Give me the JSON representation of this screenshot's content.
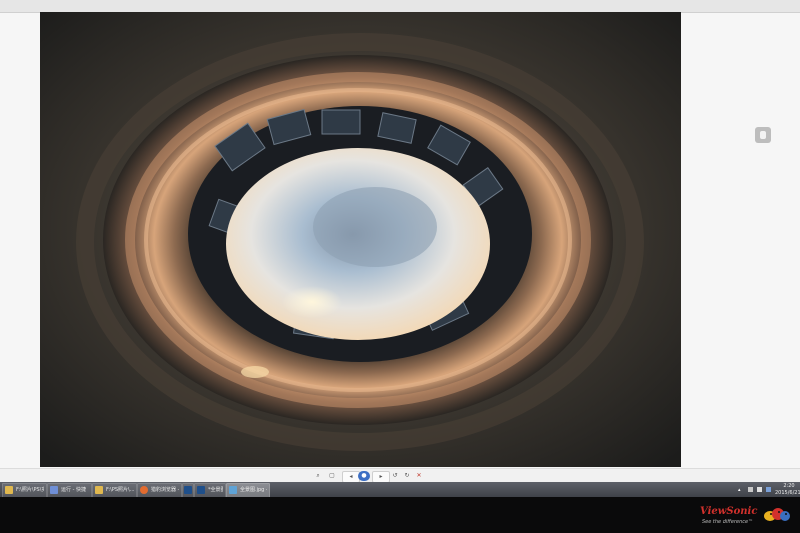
{
  "window": {
    "title": ""
  },
  "photo": {
    "description_icon": "tiny-planet-photo",
    "sky_color": "#a9bdd0",
    "glow_color": "#f2d9b8",
    "ring_color": "#d7a47a"
  },
  "side_button": {
    "icon": "page-icon"
  },
  "toolbar": {
    "buttons": [
      {
        "icon": "zoom-icon",
        "label": ""
      },
      {
        "icon": "fit-icon",
        "label": ""
      },
      {
        "icon": "slideshow-icon",
        "label": ""
      },
      {
        "icon": "rotate-left-icon",
        "label": ""
      },
      {
        "icon": "rotate-right-icon",
        "label": ""
      },
      {
        "icon": "delete-icon",
        "label": ""
      }
    ]
  },
  "taskbar": {
    "items": [
      {
        "icon": "folder-icon",
        "label": "F:\\照片\\PS\\实验"
      },
      {
        "icon": "app-icon",
        "label": "运行 - 快捷"
      },
      {
        "icon": "folder-icon",
        "label": "F:\\PS照片\\..."
      },
      {
        "icon": "browser-icon",
        "label": "猎豹浏览器 - 小生..."
      },
      {
        "icon": "photoshop-icon",
        "label": "Ps"
      },
      {
        "icon": "photoshop-icon",
        "label": "*全景图.psd @..."
      },
      {
        "icon": "image-viewer-icon",
        "label": "全景图.jpg - 照..."
      }
    ],
    "clock_time": "2:20",
    "clock_date": "2015/6/21"
  },
  "monitor": {
    "brand": "ViewSonic",
    "slogan": "See the difference™",
    "brand_color": "#d2312c"
  }
}
